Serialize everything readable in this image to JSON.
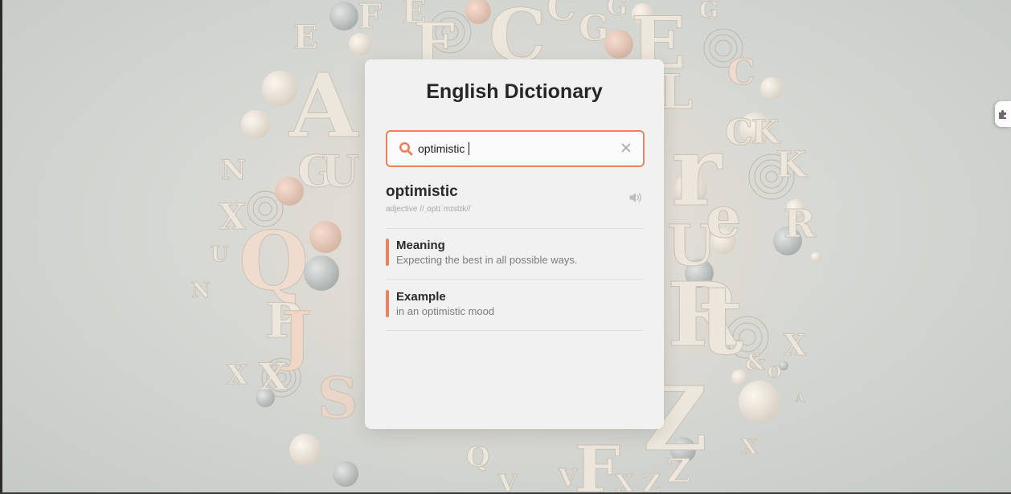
{
  "app": {
    "title": "English Dictionary"
  },
  "search": {
    "value": "optimistic",
    "icon": "search-icon",
    "clear_icon": "close-icon"
  },
  "result": {
    "word": "optimistic",
    "phonetic": "adjective //ˌɒptɪˈmɪstɪk//",
    "speaker_icon": "speaker-icon"
  },
  "entries": [
    {
      "label": "Meaning",
      "text": "Expecting the best in all possible ways."
    },
    {
      "label": "Example",
      "text": "in an optimistic mood"
    }
  ],
  "colors": {
    "accent": "#e8825f",
    "card": "#f1f1f1",
    "title": "#262626"
  }
}
